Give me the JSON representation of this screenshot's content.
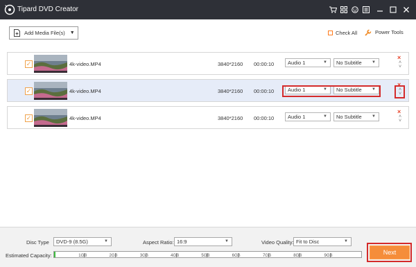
{
  "app": {
    "title": "Tipard DVD Creator"
  },
  "toolbar": {
    "add_media_label": "Add Media File(s)",
    "check_all_label": "Check All",
    "power_tools_label": "Power Tools"
  },
  "rows": [
    {
      "filename": "4k-video.MP4",
      "resolution": "3840*2160",
      "duration": "00:00:10",
      "audio": "Audio 1",
      "subtitle": "No Subtitle",
      "checked": true,
      "selected": false
    },
    {
      "filename": "4k-video.MP4",
      "resolution": "3840*2160",
      "duration": "00:00:10",
      "audio": "Audio 1",
      "subtitle": "No Subtitle",
      "checked": true,
      "selected": true
    },
    {
      "filename": "4k-video.MP4",
      "resolution": "3840*2160",
      "duration": "00:00:10",
      "audio": "Audio 1",
      "subtitle": "No Subtitle",
      "checked": true,
      "selected": false
    }
  ],
  "bottom": {
    "disc_type_label": "Disc Type",
    "disc_type_value": "DVD-9 (8.5G)",
    "aspect_ratio_label": "Aspect Ratio:",
    "aspect_ratio_value": "16:9",
    "video_quality_label": "Video Quality:",
    "video_quality_value": "Fit to Disc",
    "capacity_label": "Estimated Capacity:",
    "capacity_fraction": 0.005,
    "capacity_ticks": [
      "1GB",
      "2GB",
      "3GB",
      "4GB",
      "5GB",
      "6GB",
      "7GB",
      "8GB",
      "9GB"
    ],
    "next_label": "Next"
  },
  "colors": {
    "accent": "#f58d3a",
    "titlebar": "#2e3037",
    "highlight": "#d42a2a",
    "capacity_fill": "#3fbf3f"
  }
}
